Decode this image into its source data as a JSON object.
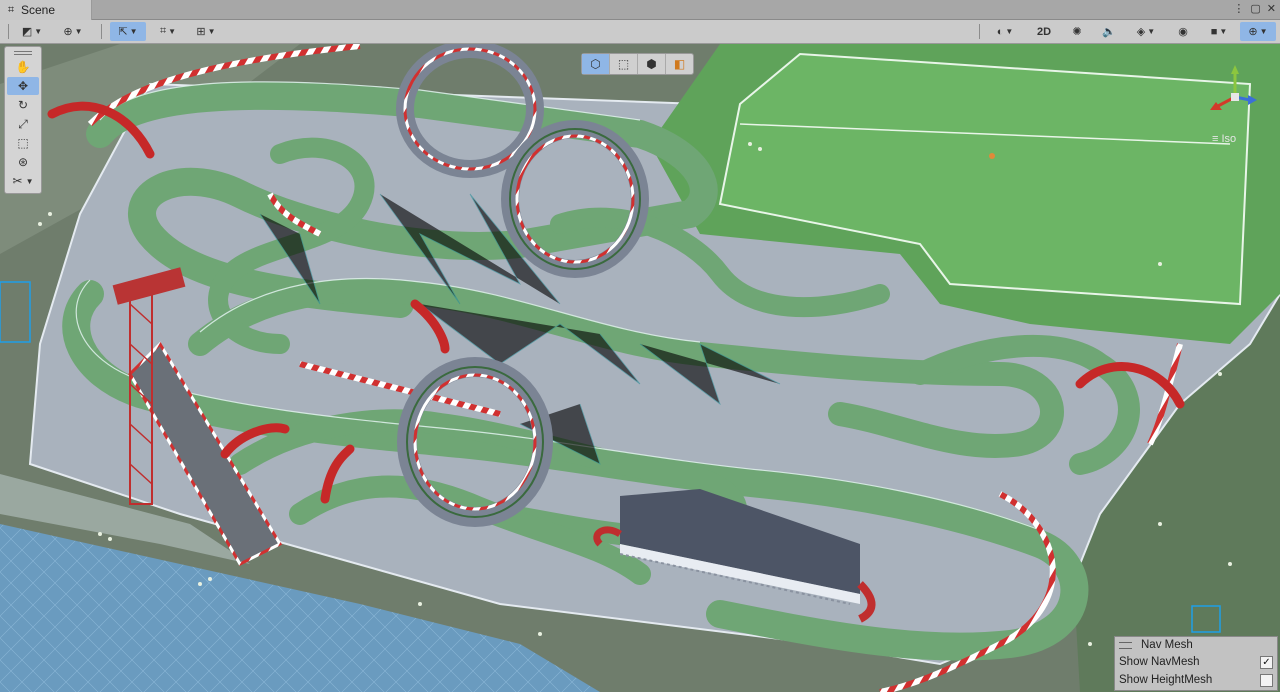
{
  "tabbar": {
    "tab_title": "Scene",
    "tab_icon": "grid-icon",
    "window_buttons": [
      "⋮",
      "▢",
      "✕"
    ]
  },
  "toolbar": {
    "left": [
      {
        "name": "draw-mode-dropdown",
        "icon": "draw-mode-icon",
        "glyph": "◩",
        "has_caret": true
      },
      {
        "name": "global-local-dropdown",
        "icon": "globe-icon",
        "glyph": "⊕",
        "has_caret": true
      },
      {
        "name": "pivot-toggle",
        "icon": "pivot-icon",
        "glyph": "⇱",
        "has_caret": true,
        "active": true
      },
      {
        "name": "grid-snapping-dropdown",
        "icon": "grid-snap-icon",
        "glyph": "⌗",
        "has_caret": true
      },
      {
        "name": "increment-snapping-dropdown",
        "icon": "ruler-icon",
        "glyph": "⊞",
        "has_caret": true
      }
    ],
    "right": [
      {
        "name": "shading-mode-dropdown",
        "icon": "sphere-icon",
        "glyph": "◐",
        "has_caret": true
      },
      {
        "name": "2d-toggle",
        "label": "2D"
      },
      {
        "name": "lighting-toggle",
        "icon": "lightbulb-icon",
        "glyph": "✺"
      },
      {
        "name": "audio-toggle",
        "icon": "speaker-icon",
        "glyph": "🔈"
      },
      {
        "name": "effects-dropdown",
        "icon": "layers-icon",
        "glyph": "◈",
        "has_caret": true
      },
      {
        "name": "visibility-toggle",
        "icon": "eye-slash-icon",
        "glyph": "◉",
        "has_caret": false
      },
      {
        "name": "camera-dropdown",
        "icon": "camera-icon",
        "glyph": "■",
        "has_caret": true
      },
      {
        "name": "gizmos-dropdown",
        "icon": "gizmo-globe-icon",
        "glyph": "⊕",
        "has_caret": true,
        "active": true
      }
    ]
  },
  "tools": [
    {
      "name": "hand-tool",
      "icon": "hand-icon",
      "glyph": "✋"
    },
    {
      "name": "move-tool",
      "icon": "move-icon",
      "glyph": "✥",
      "active": true
    },
    {
      "name": "rotate-tool",
      "icon": "rotate-icon",
      "glyph": "↻"
    },
    {
      "name": "scale-tool",
      "icon": "scale-icon",
      "glyph": "⤢"
    },
    {
      "name": "rect-tool",
      "icon": "rect-icon",
      "glyph": "⬚"
    },
    {
      "name": "transform-tool",
      "icon": "transform-icon",
      "glyph": "⊛"
    },
    {
      "name": "custom-tool",
      "icon": "custom-tools-icon",
      "glyph": "✂"
    }
  ],
  "center_tools": [
    {
      "name": "navmesh-tool-cube",
      "icon": "cube-outline-icon",
      "glyph": "⬡",
      "active": true
    },
    {
      "name": "navmesh-tool-rect",
      "icon": "rect-select-icon",
      "glyph": "⬚"
    },
    {
      "name": "navmesh-tool-box",
      "icon": "box-icon",
      "glyph": "⬢"
    },
    {
      "name": "navmesh-tool-orange",
      "icon": "orange-cube-icon",
      "glyph": "◧"
    }
  ],
  "gizmo": {
    "projection_label": "Iso",
    "axis_colors": {
      "x": "#d23a2a",
      "y": "#8cc63f",
      "z": "#3b6fd8"
    }
  },
  "navmesh_panel": {
    "title": "Nav Mesh",
    "rows": [
      {
        "label": "Show NavMesh",
        "checked": true
      },
      {
        "label": "Show HeightMesh",
        "checked": false
      }
    ]
  },
  "colors": {
    "accent": "#8fb6e6",
    "track_green": "#6fa675",
    "navmesh_teal": "#2a8f9a",
    "curb_red": "#cc2b2b",
    "field_green": "#5fa35a"
  }
}
